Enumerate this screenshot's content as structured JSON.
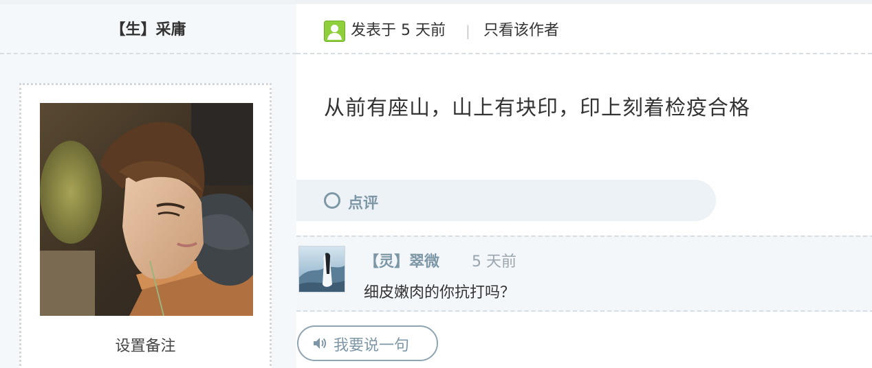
{
  "sidebar": {
    "author_name": "【生】采庸",
    "remark_label": "设置备注"
  },
  "post": {
    "posted_text": "发表于 5 天前",
    "separator": "|",
    "only_author_label": "只看该作者",
    "content": "从前有座山，山上有块印，印上刻着检疫合格"
  },
  "comments": {
    "label": "点评",
    "items": [
      {
        "user": "【灵】翠微",
        "time": "5 天前",
        "text": "细皮嫩肉的你抗打吗？"
      }
    ]
  },
  "reply_button": {
    "label": "我要说一句"
  },
  "colors": {
    "accent": "#7e97a6",
    "sidebar_bg": "#f4f8fa",
    "user_icon": "#8fcf3c"
  },
  "icons": {
    "user": "user-icon",
    "comment": "circle-icon",
    "speaker": "speaker-icon"
  }
}
